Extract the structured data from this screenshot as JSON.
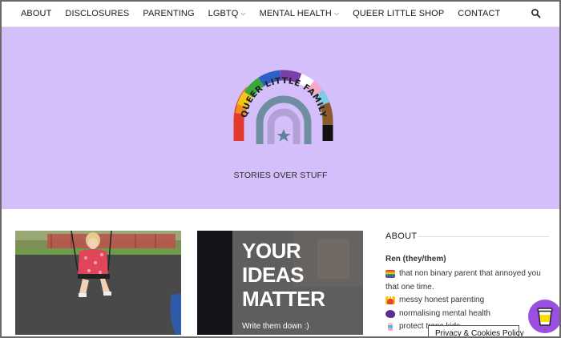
{
  "nav": {
    "items": [
      {
        "label": "ABOUT",
        "dropdown": false
      },
      {
        "label": "DISCLOSURES",
        "dropdown": false
      },
      {
        "label": "PARENTING",
        "dropdown": false
      },
      {
        "label": "LGBTQ",
        "dropdown": true
      },
      {
        "label": "MENTAL HEALTH",
        "dropdown": true
      },
      {
        "label": "QUEER LITTLE SHOP",
        "dropdown": false
      },
      {
        "label": "CONTACT",
        "dropdown": false
      }
    ],
    "search_icon": "search-icon"
  },
  "hero": {
    "logo_text": "QUEER LITTLE FAMILY",
    "tagline": "STORIES OVER STUFF",
    "background": "#d4bffa"
  },
  "posts": [
    {
      "image": "child-on-swing-photo"
    },
    {
      "image": "your-ideas-matter-sign-photo",
      "sign_text": [
        "YOUR",
        "IDEAS",
        "MATTER"
      ],
      "sign_subtext": "Write them down :)"
    }
  ],
  "sidebar": {
    "heading": "ABOUT",
    "name": "Ren (they/them)",
    "bio_lines": [
      {
        "icon": "rainbow-flag-icon",
        "text": "that non binary parent that annoyed you"
      },
      {
        "icon": "",
        "text": "that one time."
      },
      {
        "icon": "fries-icon",
        "text": "messy honest parenting"
      },
      {
        "icon": "head-icon",
        "text": "normalising mental health"
      },
      {
        "icon": "person-icon",
        "text": "protect trans kids"
      }
    ]
  },
  "cookie_banner": {
    "label": "Privacy & Cookies Policy"
  },
  "support_button": {
    "icon": "coffee-cup-icon"
  }
}
